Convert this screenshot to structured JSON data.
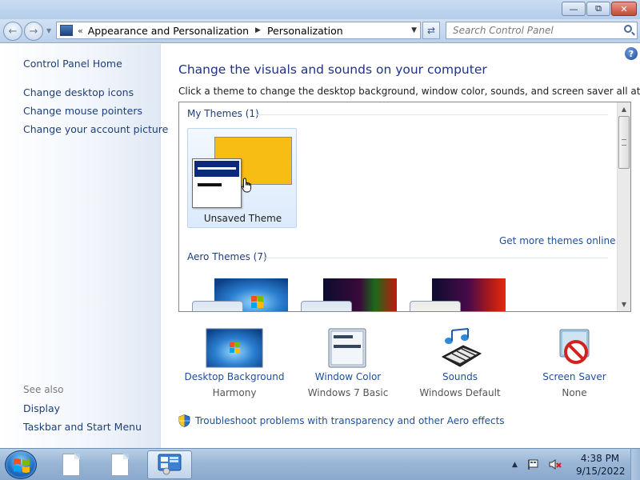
{
  "nav": {
    "breadcrumb_prefix": "«",
    "crumbs": [
      "Appearance and Personalization",
      "Personalization"
    ]
  },
  "search": {
    "placeholder": "Search Control Panel"
  },
  "left_pane": {
    "home": "Control Panel Home",
    "links": [
      "Change desktop icons",
      "Change mouse pointers",
      "Change your account picture"
    ],
    "see_also_heading": "See also",
    "see_also": [
      "Display",
      "Taskbar and Start Menu"
    ]
  },
  "main": {
    "title": "Change the visuals and sounds on your computer",
    "description": "Click a theme to change the desktop background, window color, sounds, and screen saver all at once.",
    "my_themes_header": "My Themes (1)",
    "unsaved_theme_label": "Unsaved Theme",
    "more_themes_link": "Get more themes online",
    "aero_themes_header": "Aero Themes (7)"
  },
  "settings": [
    {
      "label": "Desktop Background",
      "value": "Harmony",
      "icon": "desktop-background-icon"
    },
    {
      "label": "Window Color",
      "value": "Windows 7 Basic",
      "icon": "window-color-icon"
    },
    {
      "label": "Sounds",
      "value": "Windows Default",
      "icon": "sounds-icon"
    },
    {
      "label": "Screen Saver",
      "value": "None",
      "icon": "screen-saver-icon"
    }
  ],
  "troubleshoot_link": "Troubleshoot problems with transparency and other Aero effects",
  "taskbar": {
    "time": "4:38 PM",
    "date": "9/15/2022"
  },
  "colors": {
    "link": "#1e4f9a",
    "title": "#1e3287",
    "theme_swatch": "#f7bd12",
    "window_bar": "#0d2a7a"
  }
}
